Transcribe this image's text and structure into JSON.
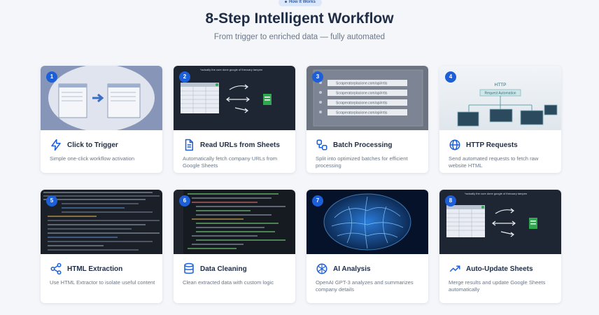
{
  "header": {
    "badge": "How It Works",
    "title": "8-Step Intelligent Workflow",
    "subtitle": "From trigger to enriched data — fully automated"
  },
  "accent": "#1d5fd8",
  "steps": [
    {
      "num": "1",
      "title": "Click to Trigger",
      "desc": "Simple one-click workflow activation",
      "icon": "lightning-icon"
    },
    {
      "num": "2",
      "title": "Read URLs from Sheets",
      "desc": "Automatically fetch company URLs from Google Sheets",
      "icon": "document-icon"
    },
    {
      "num": "3",
      "title": "Batch Processing",
      "desc": "Split into optimized batches for efficient processing",
      "icon": "batch-icon"
    },
    {
      "num": "4",
      "title": "HTTP Requests",
      "desc": "Send automated requests to fetch raw website HTML",
      "icon": "globe-icon"
    },
    {
      "num": "5",
      "title": "HTML Extraction",
      "desc": "Use HTML Extractor to isolate useful content",
      "icon": "share-icon"
    },
    {
      "num": "6",
      "title": "Data Cleaning",
      "desc": "Clean extracted data with custom logic",
      "icon": "database-icon"
    },
    {
      "num": "7",
      "title": "AI Analysis",
      "desc": "OpenAI GPT-3 analyzes and summarizes company details",
      "icon": "ai-icon"
    },
    {
      "num": "8",
      "title": "Auto-Update Sheets",
      "desc": "Merge results and update Google Sheets automatically",
      "icon": "trending-icon"
    }
  ],
  "thumbs": {
    "sheets_caption": "*actually the cure done google of thecuary tampen",
    "batch_rows": [
      "Scraperatorplacione.com/api/rrtis",
      "Scraperatorplacione.com/api/rrtis",
      "Scraperatorplacione.com/api/rrtis",
      "Scraperatorplacione.com/api/rrtis"
    ],
    "http_title": "HTTP",
    "http_label": "Request Automation"
  }
}
